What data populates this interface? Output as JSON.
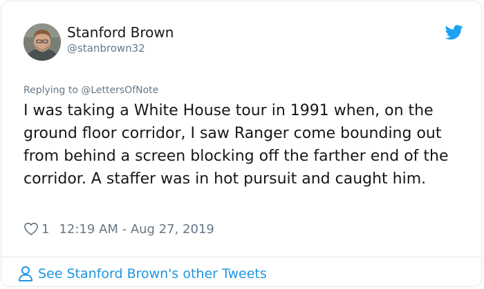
{
  "author": {
    "name": "Stanford Brown",
    "handle": "@stanbrown32"
  },
  "tweet": {
    "reply_to": "Replying to @LettersOfNote",
    "text": "I was taking a White House tour in 1991 when, on the ground floor corridor, I saw Ranger come bounding out from behind a screen blocking off the farther end of the corridor. A staffer was in hot pursuit and caught him.",
    "likes": "1",
    "timestamp": "12:19 AM - Aug 27, 2019"
  },
  "footer": {
    "link_text": "See Stanford Brown's other Tweets"
  },
  "icons": {
    "brand": "twitter-bird-icon",
    "like": "heart-outline-icon",
    "profile": "person-outline-icon"
  },
  "colors": {
    "brand_blue": "#1da1f2",
    "link_blue": "#1b95e0",
    "text_primary": "#14171a",
    "text_secondary": "#657786",
    "border": "#e1e8ed"
  }
}
